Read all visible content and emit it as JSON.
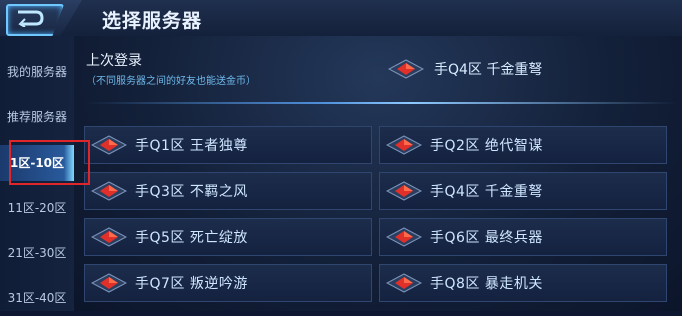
{
  "header": {
    "title": "选择服务器"
  },
  "sidebar": {
    "items": [
      {
        "label": "我的服务器"
      },
      {
        "label": "推荐服务器"
      },
      {
        "label": "1区-10区",
        "active": true
      },
      {
        "label": "11区-20区"
      },
      {
        "label": "21区-30区"
      },
      {
        "label": "31区-40区"
      }
    ]
  },
  "last_login": {
    "title": "上次登录",
    "subtitle": "（不同服务器之间的好友也能送金币）",
    "server": "手Q4区  千金重弩"
  },
  "servers": [
    {
      "label": "手Q1区  王者独尊"
    },
    {
      "label": "手Q2区  绝代智谋"
    },
    {
      "label": "手Q3区  不羁之风"
    },
    {
      "label": "手Q4区  千金重弩"
    },
    {
      "label": "手Q5区  死亡绽放"
    },
    {
      "label": "手Q6区  最终兵器"
    },
    {
      "label": "手Q7区  叛逆吟游"
    },
    {
      "label": "手Q8区  暴走机关"
    }
  ],
  "colors": {
    "accent": "#6fc8ff",
    "highlight_box": "#e0262a",
    "gem_red": "#e0302a"
  },
  "icons": {
    "back": "back-arrow-icon",
    "server": "server-gem-icon"
  }
}
